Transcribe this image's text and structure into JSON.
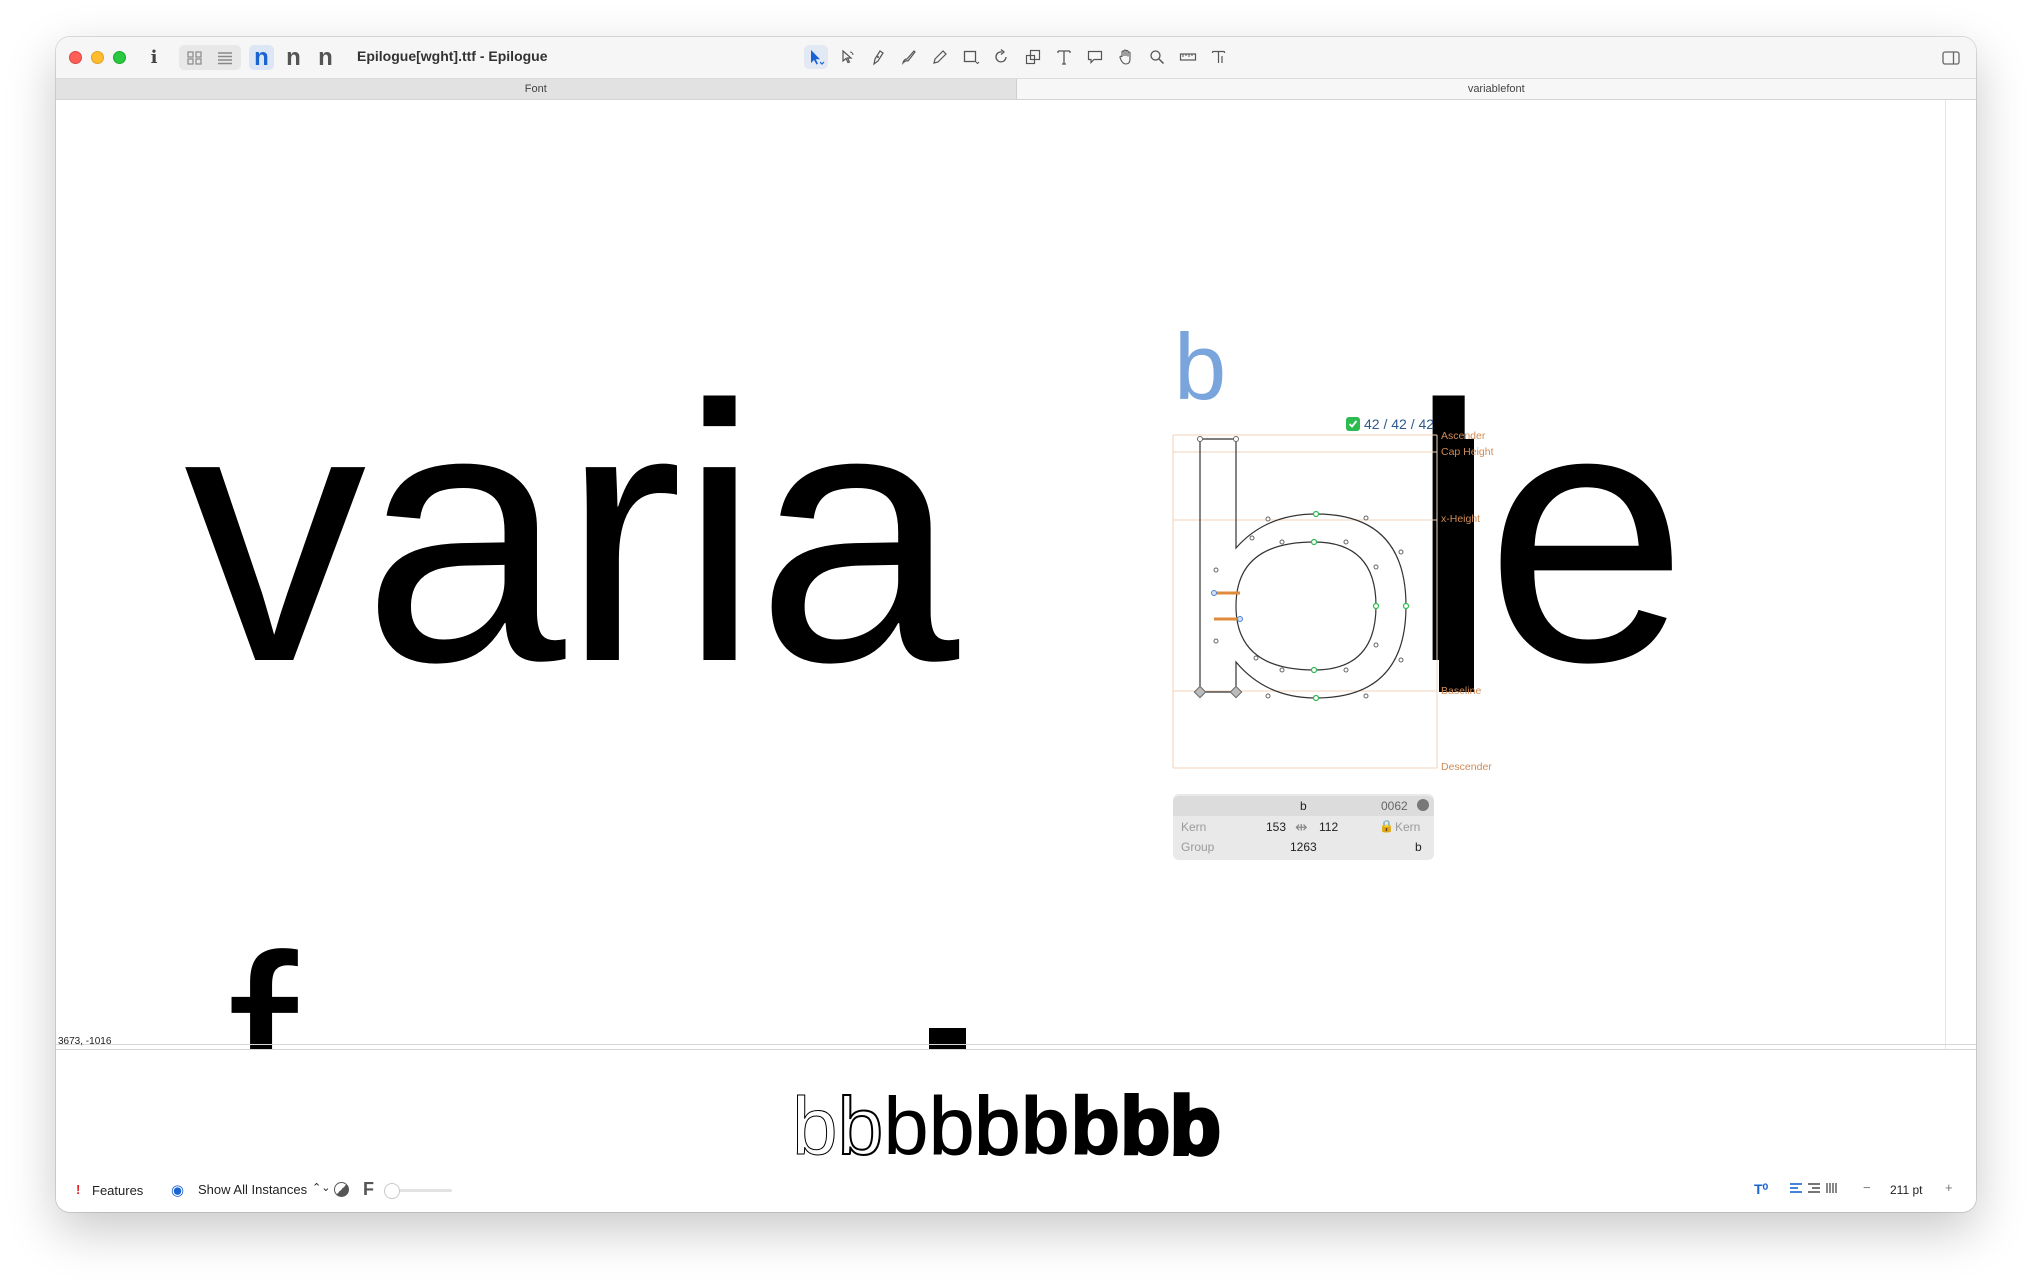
{
  "window": {
    "title": "Epilogue[wght].ttf - Epilogue",
    "info_label": "i",
    "n_buttons": [
      "n",
      "n",
      "n"
    ]
  },
  "tabs": [
    {
      "label": "Font",
      "active": false
    },
    {
      "label": "variablefont",
      "active": true
    }
  ],
  "toolbar": {
    "tools": [
      "select-tool",
      "hand-select-tool",
      "pen-tool",
      "draw-tool",
      "pencil-tool",
      "rectangle-tool",
      "rotate-tool",
      "scale-tool",
      "text-tool",
      "annotation-tool",
      "hand-tool",
      "zoom-tool",
      "measure-tool",
      "type-tool"
    ]
  },
  "canvas": {
    "text_before": "varia",
    "active_glyph": "b",
    "text_after": "le",
    "second_line_partial": "f",
    "glyph_label": "b",
    "compatibility_badge": "42 / 42 / 42",
    "metrics": {
      "ascender": "Ascender",
      "cap_height": "Cap Height",
      "x_height": "x-Height",
      "baseline": "Baseline",
      "descender": "Descender"
    },
    "cursor_coordinates": "3673, -1016"
  },
  "glyph_info": {
    "name": "b",
    "unicode": "0062",
    "kern_label_left": "Kern",
    "lsb": "153",
    "rsb": "112",
    "kern_label_right": "Kern",
    "group_label": "Group",
    "width": "1263",
    "group_right": "b"
  },
  "preview": {
    "glyphs": [
      "b",
      "b",
      "b",
      "b",
      "b",
      "b",
      "b",
      "b",
      "b"
    ],
    "weights": [
      100,
      200,
      300,
      400,
      500,
      600,
      700,
      800,
      900
    ]
  },
  "bottom_bar": {
    "features_label": "Features",
    "instances_label": "Show All Instances",
    "f_label": "F",
    "zoom": "211 pt"
  },
  "colors": {
    "accent": "#1a64d2",
    "metric_line": "#f1c9a8",
    "glyph_label": "#7aa5dc"
  }
}
